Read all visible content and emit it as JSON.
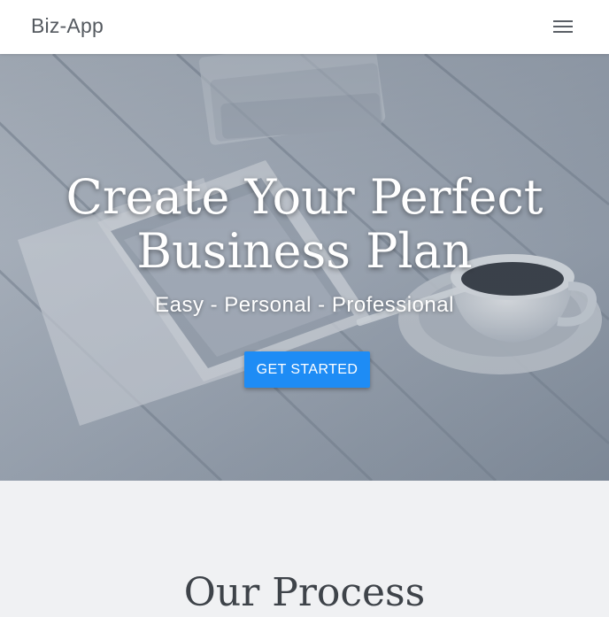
{
  "navbar": {
    "brand": "Biz-App",
    "menu_icon": "hamburger-menu-icon"
  },
  "hero": {
    "title_line1": "Create Your Perfect",
    "title_line2": "Business Plan",
    "subtitle": "Easy - Personal - Professional",
    "cta_label": "GET STARTED",
    "cta_color": "#1e8cf5"
  },
  "process": {
    "title": "Our Process"
  },
  "colors": {
    "navbar_bg": "#ffffff",
    "section_bg": "#f0f1f3",
    "accent": "#1e8cf5"
  }
}
